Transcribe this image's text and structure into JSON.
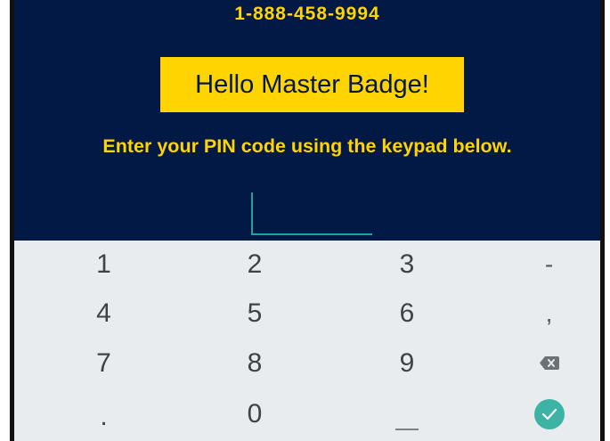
{
  "header": {
    "phone": "1-888-458-9994",
    "greeting": "Hello Master Badge!",
    "prompt": "Enter your PIN code using the keypad below."
  },
  "pin": {
    "value": ""
  },
  "keypad": {
    "keys": [
      "1",
      "2",
      "3",
      "-",
      "4",
      "5",
      "6",
      ",",
      "7",
      "8",
      "9",
      ".",
      "0"
    ],
    "icons": [
      "backspace-icon",
      "space-icon",
      "checkmark-icon"
    ]
  },
  "colors": {
    "background": "#021845",
    "accent": "#ffd400",
    "cursor": "#20a39e",
    "keypad": "#e8ecef",
    "done": "#3cb3a5"
  }
}
